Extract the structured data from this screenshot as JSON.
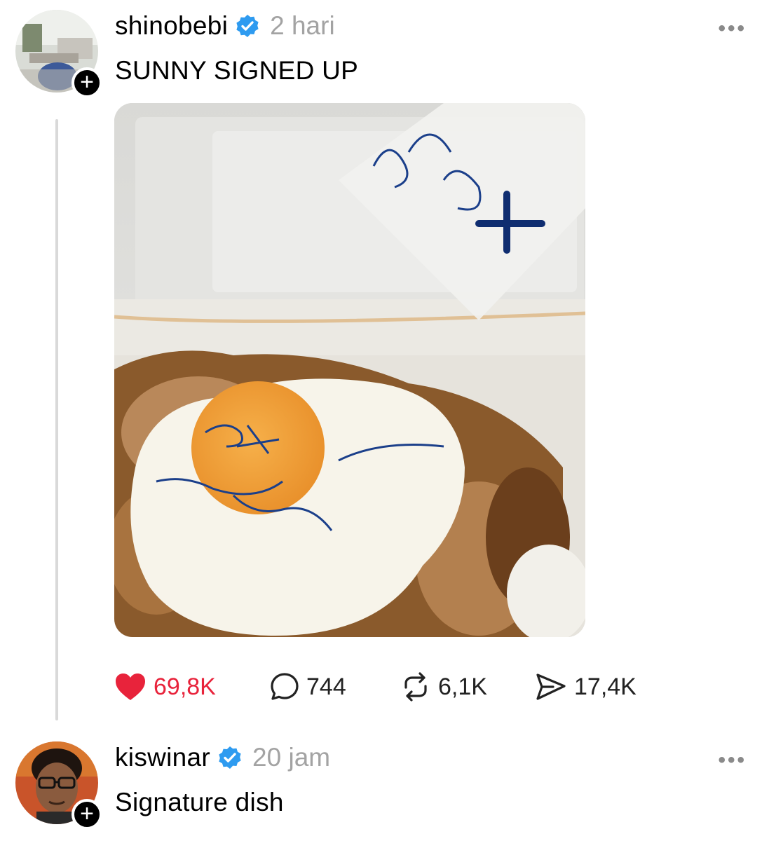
{
  "posts": [
    {
      "username": "shinobebi",
      "time": "2 hari",
      "text": "SUNNY SIGNED UP",
      "stats": {
        "likes": "69,8K",
        "comments": "744",
        "reposts": "6,1K",
        "shares": "17,4K"
      }
    },
    {
      "username": "kiswinar",
      "time": "20 jam",
      "text": "Signature dish"
    }
  ],
  "more_label": "•••",
  "follow_symbol": "+",
  "colors": {
    "verified": "#2e9bf0",
    "like": "#e8233b",
    "muted": "#a3a3a3",
    "thread_line": "#d9d9d9"
  },
  "icons": [
    "verified-badge-icon",
    "heart-icon",
    "comment-icon",
    "repost-icon",
    "share-icon",
    "more-icon"
  ]
}
